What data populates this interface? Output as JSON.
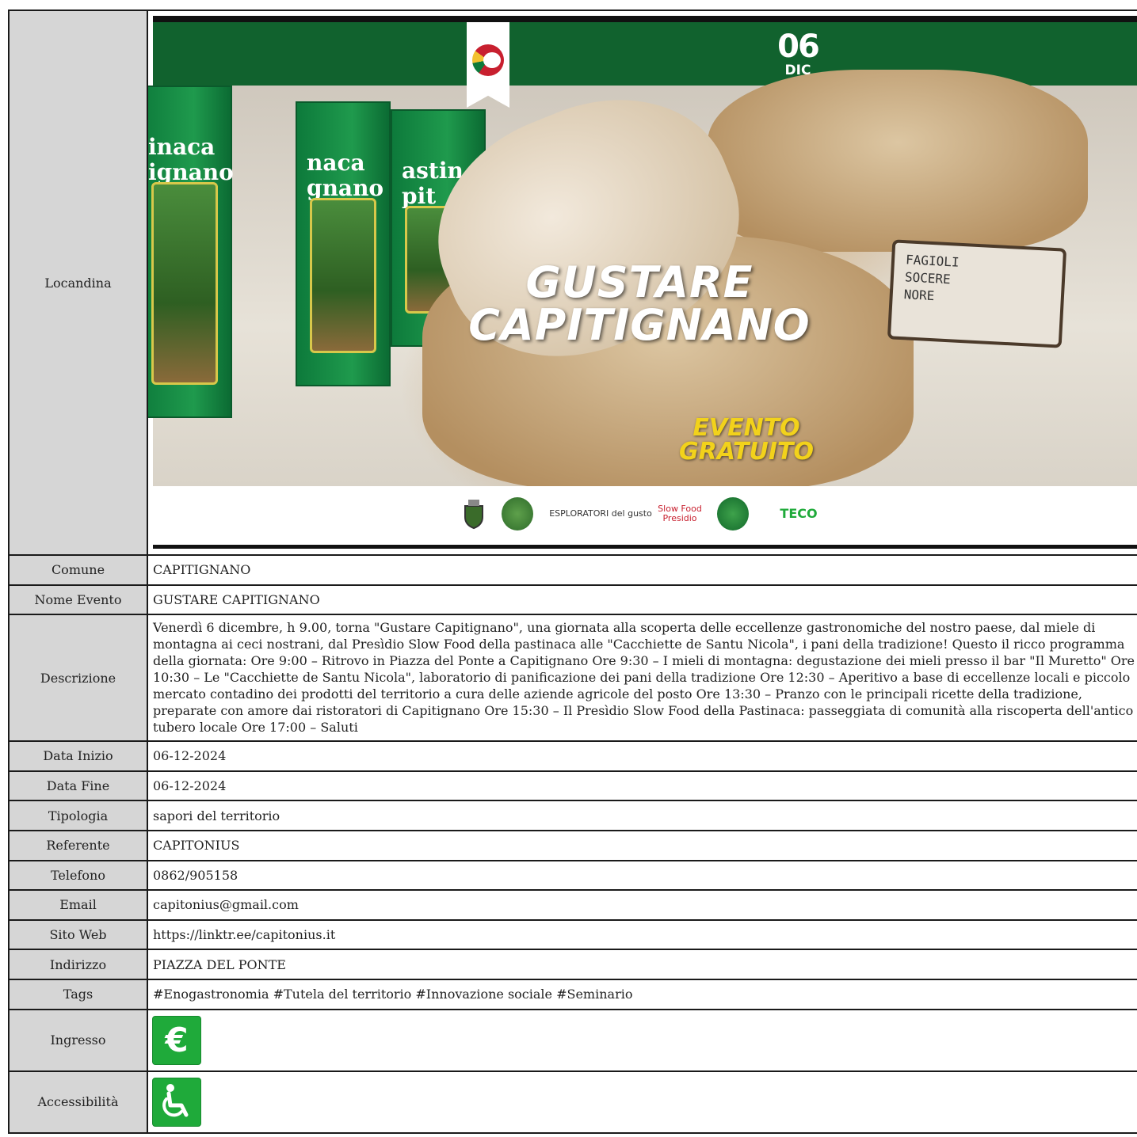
{
  "labels": {
    "poster": "Locandina",
    "comune": "Comune",
    "nome_evento": "Nome Evento",
    "descrizione": "Descrizione",
    "data_inizio": "Data Inizio",
    "data_fine": "Data Fine",
    "tipologia": "Tipologia",
    "referente": "Referente",
    "telefono": "Telefono",
    "email": "Email",
    "sito_web": "Sito Web",
    "indirizzo": "Indirizzo",
    "tags": "Tags",
    "ingresso": "Ingresso",
    "accessibilita": "Accessibilità"
  },
  "values": {
    "comune": "CAPITIGNANO",
    "nome_evento": "GUSTARE CAPITIGNANO",
    "descrizione": "Venerdì 6 dicembre, h 9.00, torna \"Gustare Capitignano\", una giornata alla scoperta delle eccellenze gastronomiche del nostro paese, dal miele di montagna ai ceci nostrani, dal Presìdio Slow Food della pastinaca alle \"Cacchiette de Santu Nicola\", i pani della tradizione! Questo il ricco programma della giornata: Ore 9:00 – Ritrovo in Piazza del Ponte a Capitignano Ore 9:30 – I mieli di montagna: degustazione dei mieli presso il bar \"Il Muretto\" Ore 10:30 – Le \"Cacchiette de Santu Nicola\", laboratorio di panificazione dei pani della tradizione Ore 12:30 – Aperitivo a base di eccellenze locali e piccolo mercato contadino dei prodotti del territorio a cura delle aziende agricole del posto Ore 13:30 – Pranzo con le principali ricette della tradizione, preparate con amore dai ristoratori di Capitignano Ore 15:30 – Il Presìdio Slow Food della Pastinaca: passeggiata di comunità alla riscoperta dell'antico tubero locale Ore 17:00 – Saluti",
    "data_inizio": "06-12-2024",
    "data_fine": "06-12-2024",
    "tipologia": "sapori del territorio",
    "referente": "CAPITONIUS",
    "telefono": "0862/905158",
    "email": "capitonius@gmail.com",
    "sito_web": "https://linktr.ee/capitonius.it",
    "indirizzo": "PIAZZA DEL PONTE",
    "tags": "#Enogastronomia #Tutela del territorio #Innovazione sociale #Seminario"
  },
  "poster": {
    "date_day": "06",
    "date_month": "DIC",
    "headline_1": "GUSTARE",
    "headline_2": "CAPITIGNANO",
    "free_1": "EVENTO",
    "free_2": "GRATUITO",
    "book_text_1": "inaca",
    "book_text_2": "ignano",
    "book_text_3": "naca",
    "book_text_4": "gnano",
    "book_text_5": "astin",
    "book_text_6": "pit",
    "sign_text": "FAGIOLI\nSOCERE\nNORE",
    "sponsors": [
      "ESPLORATORI del gusto",
      "Slow Food Presidio",
      "TECO"
    ],
    "colors": {
      "green_bar": "#11622e",
      "gold": "#f2d21b",
      "logo_red": "#c8202f"
    }
  },
  "icons": {
    "ingresso": "euro-icon",
    "accessibilita": "wheelchair-icon",
    "ingresso_color": "#1faa3a"
  }
}
